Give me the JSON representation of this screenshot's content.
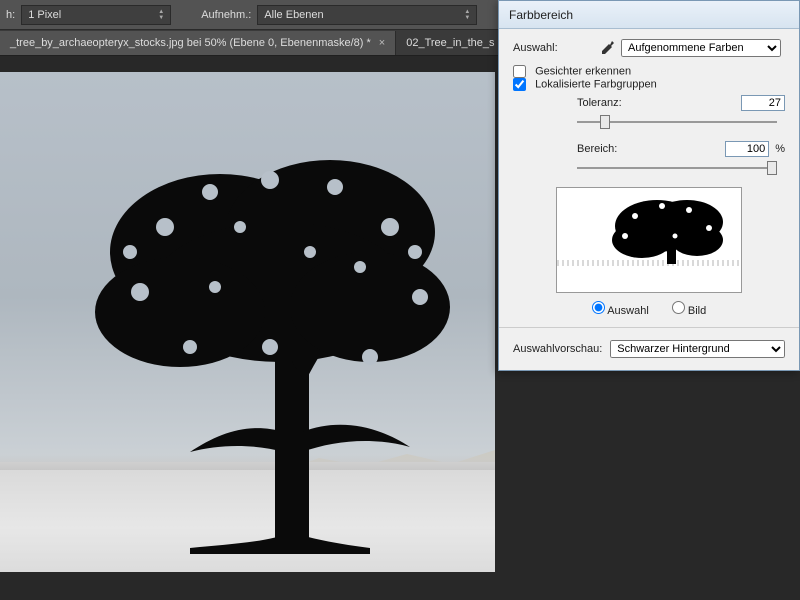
{
  "optbar": {
    "thickness_label": "h:",
    "thickness_value": "1 Pixel",
    "sample_label": "Aufnehm.:",
    "sample_value": "Alle Ebenen"
  },
  "tabs": [
    {
      "label": "_tree_by_archaeopteryx_stocks.jpg bei 50% (Ebene 0, Ebenenmaske/8) *",
      "active": true
    },
    {
      "label": "02_Tree_in_the_s",
      "active": false
    }
  ],
  "dialog": {
    "title": "Farbbereich",
    "select_label": "Auswahl:",
    "select_value": "Aufgenommene Farben",
    "detect_faces": {
      "label": "Gesichter erkennen",
      "checked": false
    },
    "localized": {
      "label": "Lokalisierte Farbgruppen",
      "checked": true
    },
    "tolerance": {
      "label": "Toleranz:",
      "value": "27",
      "pos_pct": 12
    },
    "range": {
      "label": "Bereich:",
      "value": "100",
      "unit": "%",
      "pos_pct": 100
    },
    "radio_selection": "Auswahl",
    "radio_image": "Bild",
    "radio_checked": "selection",
    "preview_label": "Auswahlvorschau:",
    "preview_value": "Schwarzer Hintergrund"
  }
}
